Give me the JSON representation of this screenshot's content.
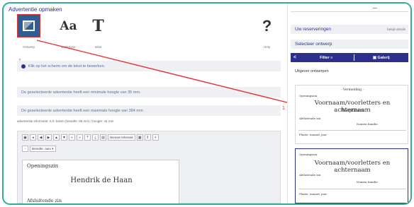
{
  "left": {
    "title": "Advertentie opmaken",
    "tools": [
      {
        "icon": "image-icon",
        "label": "Ontwerp"
      },
      {
        "icon": "font-icon",
        "label": "Lettertype",
        "glyph": "Aa"
      },
      {
        "icon": "text-icon",
        "label": "tekst",
        "glyph": "T"
      },
      {
        "icon": "help-icon",
        "label": "Help",
        "glyph": "?"
      }
    ],
    "marker_left": "1",
    "info": "Klik op het scherm om de tekst te bewerken.",
    "min_height_msg": "De geselecteerde advertentie heeft een minimale hoogte van 35 mm.",
    "max_height_msg": "De geselecteerde advertentie heeft een maximale hoogte van 384 mm.",
    "ad_info": "advertentie informatie: 2,0- kolom (breedte: 86 mm) / hoogte: 44 mm",
    "toolbar": {
      "new_line_label": "Nieuwe tekstvak",
      "width_label": "Breedte: auto"
    },
    "sheet": {
      "opening": "Openingszin",
      "name": "Hendrik de Haan",
      "closing": "Afsluitende zin"
    }
  },
  "right": {
    "reservations": "Uw reserveringen",
    "reservations_link": "bekijk details",
    "select_design": "Selecteer ontwerp",
    "filter_label": "Filter ≡",
    "gallery_label": "Galerij",
    "back_glyph": "<",
    "publisher_designs": "Uitgever ontwerpen",
    "card1": {
      "top_note": "- Vermelding -",
      "opening": "Openingszin",
      "names": "Voornaam/voorletters en achternaam",
      "callname": "Roepnaam",
      "closing": "Afsluitende zin",
      "family": "Namen familie",
      "place": "Plaats, maand, jaar"
    },
    "card2": {
      "opening": "Openingszin",
      "names": "Voornaam/voorletters en achternaam",
      "closing": "Afsluitende zin",
      "family": "Namen familie",
      "place": "Plaats, maand, jaar"
    }
  },
  "annotation_right": "1",
  "colors": {
    "accent": "#2d2f8c",
    "frame": "#37a99a",
    "annotation": "#e23232"
  }
}
